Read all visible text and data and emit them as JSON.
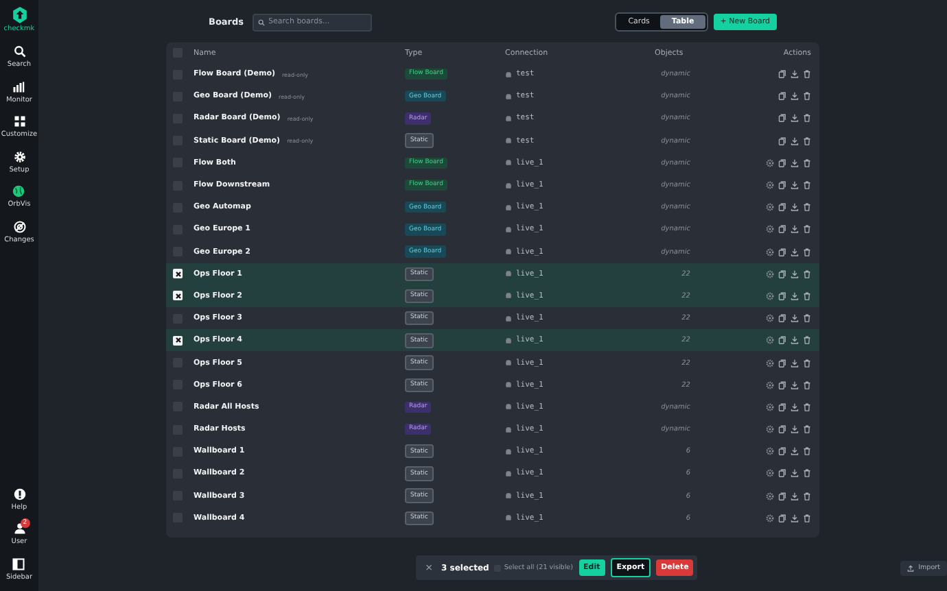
{
  "sidebar": {
    "logo": "checkmk",
    "items": [
      {
        "label": "Search",
        "selected": false
      },
      {
        "label": "Monitor",
        "selected": false
      },
      {
        "label": "Customize",
        "selected": false
      },
      {
        "label": "Setup",
        "selected": false
      },
      {
        "label": "OrbVis",
        "selected": true
      },
      {
        "label": "Changes",
        "selected": false
      }
    ],
    "bottom_items": [
      {
        "label": "Help"
      },
      {
        "label": "User",
        "badge": "2"
      },
      {
        "label": "Sidebar"
      }
    ]
  },
  "header": {
    "title": "Boards",
    "search": {
      "placeholder": "Search boards..."
    },
    "view_toggle": [
      {
        "label": "Cards",
        "selected": false
      },
      {
        "label": "Table",
        "selected": true
      }
    ],
    "new_button": "+ New Board"
  },
  "table": {
    "all_checked": false,
    "columns": [
      "Name",
      "Type",
      "Connection",
      "Objects",
      "Actions"
    ],
    "rows": [
      {
        "name": "Flow Board (Demo)",
        "tag": "read-only",
        "type": "Flow Board",
        "kind": "flow",
        "connection": "test",
        "objects": "dynamic",
        "selected": false,
        "settings": false
      },
      {
        "name": "Geo Board (Demo)",
        "tag": "read-only",
        "type": "Geo Board",
        "kind": "geo",
        "connection": "test",
        "objects": "dynamic",
        "selected": false,
        "settings": false
      },
      {
        "name": "Radar Board (Demo)",
        "tag": "read-only",
        "type": "Radar",
        "kind": "radar",
        "connection": "test",
        "objects": "dynamic",
        "selected": false,
        "settings": false
      },
      {
        "name": "Static Board (Demo)",
        "tag": "read-only",
        "type": "Static",
        "kind": "static",
        "connection": "test",
        "objects": "dynamic",
        "selected": false,
        "settings": false
      },
      {
        "name": "Flow Both",
        "type": "Flow Board",
        "kind": "flow",
        "connection": "live_1",
        "objects": "dynamic",
        "selected": false,
        "settings": true
      },
      {
        "name": "Flow Downstream",
        "type": "Flow Board",
        "kind": "flow",
        "connection": "live_1",
        "objects": "dynamic",
        "selected": false,
        "settings": true
      },
      {
        "name": "Geo Automap",
        "type": "Geo Board",
        "kind": "geo",
        "connection": "live_1",
        "objects": "dynamic",
        "selected": false,
        "settings": true
      },
      {
        "name": "Geo Europe 1",
        "type": "Geo Board",
        "kind": "geo",
        "connection": "live_1",
        "objects": "dynamic",
        "selected": false,
        "settings": true
      },
      {
        "name": "Geo Europe 2",
        "type": "Geo Board",
        "kind": "geo",
        "connection": "live_1",
        "objects": "dynamic",
        "selected": false,
        "settings": true
      },
      {
        "name": "Ops Floor 1",
        "type": "Static",
        "kind": "static",
        "connection": "live_1",
        "objects": "22",
        "selected": true,
        "settings": true
      },
      {
        "name": "Ops Floor 2",
        "type": "Static",
        "kind": "static",
        "connection": "live_1",
        "objects": "22",
        "selected": true,
        "settings": true
      },
      {
        "name": "Ops Floor 3",
        "type": "Static",
        "kind": "static",
        "connection": "live_1",
        "objects": "22",
        "selected": false,
        "settings": true
      },
      {
        "name": "Ops Floor 4",
        "type": "Static",
        "kind": "static",
        "connection": "live_1",
        "objects": "22",
        "selected": true,
        "settings": true
      },
      {
        "name": "Ops Floor 5",
        "type": "Static",
        "kind": "static",
        "connection": "live_1",
        "objects": "22",
        "selected": false,
        "settings": true
      },
      {
        "name": "Ops Floor 6",
        "type": "Static",
        "kind": "static",
        "connection": "live_1",
        "objects": "22",
        "selected": false,
        "settings": true
      },
      {
        "name": "Radar All Hosts",
        "type": "Radar",
        "kind": "radar",
        "connection": "live_1",
        "objects": "dynamic",
        "selected": false,
        "settings": true
      },
      {
        "name": "Radar Hosts",
        "type": "Radar",
        "kind": "radar",
        "connection": "live_1",
        "objects": "dynamic",
        "selected": false,
        "settings": true
      },
      {
        "name": "Wallboard 1",
        "type": "Static",
        "kind": "static",
        "connection": "live_1",
        "objects": "6",
        "selected": false,
        "settings": true
      },
      {
        "name": "Wallboard 2",
        "type": "Static",
        "kind": "static",
        "connection": "live_1",
        "objects": "6",
        "selected": false,
        "settings": true
      },
      {
        "name": "Wallboard 3",
        "type": "Static",
        "kind": "static",
        "connection": "live_1",
        "objects": "6",
        "selected": false,
        "settings": true
      },
      {
        "name": "Wallboard 4",
        "type": "Static",
        "kind": "static",
        "connection": "live_1",
        "objects": "6",
        "selected": false,
        "settings": true
      }
    ]
  },
  "selection_bar": {
    "close": "×",
    "count": "3 selected",
    "select_all": {
      "label": "Select all (21 visible)",
      "checked": false
    },
    "buttons": [
      {
        "label": "Edit",
        "kind": "edit"
      },
      {
        "label": "Export",
        "kind": "export"
      },
      {
        "label": "Delete",
        "kind": "delete"
      }
    ]
  },
  "import_button": "Import"
}
